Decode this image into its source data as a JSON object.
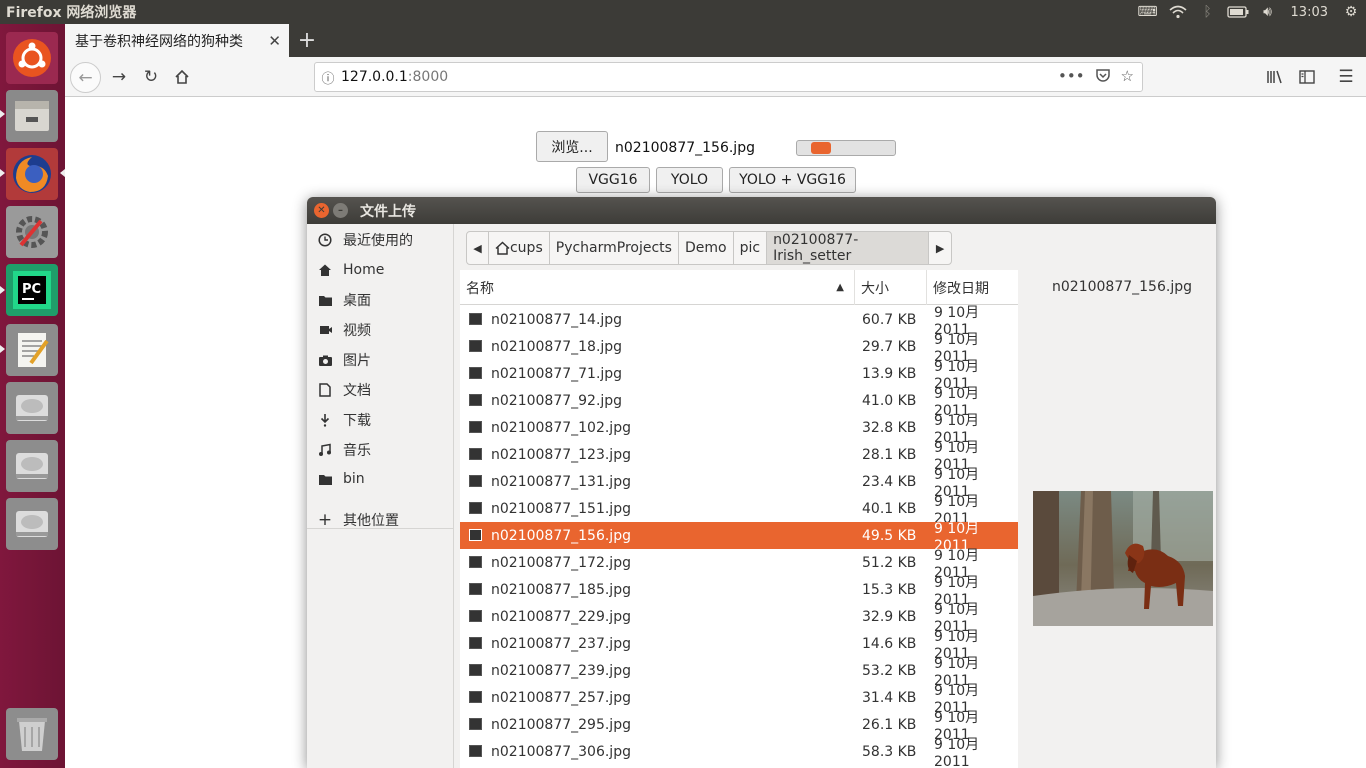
{
  "topbar": {
    "app_title": "Firefox 网络浏览器",
    "time": "13:03"
  },
  "browser": {
    "tab_title": "基于卷积神经网络的狗种类",
    "url_host": "127.0.0.1",
    "url_port": ":8000"
  },
  "page": {
    "browse_label": "浏览...",
    "selected_file": "n02100877_156.jpg",
    "upload_progress": 0.2,
    "buttons": [
      "VGG16",
      "YOLO",
      "YOLO + VGG16"
    ]
  },
  "dialog": {
    "title": "文件上传",
    "places": [
      {
        "label": "最近使用的",
        "icon": "clock-icon"
      },
      {
        "label": "Home",
        "icon": "home-icon"
      },
      {
        "label": "桌面",
        "icon": "folder-icon"
      },
      {
        "label": "视频",
        "icon": "video-icon"
      },
      {
        "label": "图片",
        "icon": "camera-icon"
      },
      {
        "label": "文档",
        "icon": "document-icon"
      },
      {
        "label": "下载",
        "icon": "download-icon"
      },
      {
        "label": "音乐",
        "icon": "music-icon"
      },
      {
        "label": "bin",
        "icon": "folder-icon"
      }
    ],
    "other_places": "其他位置",
    "breadcrumbs": [
      "cups",
      "PycharmProjects",
      "Demo",
      "pic",
      "n02100877-Irish_setter"
    ],
    "columns": {
      "name": "名称",
      "size": "大小",
      "modified": "修改日期"
    },
    "files": [
      {
        "name": "n02100877_14.jpg",
        "size": "60.7 KB",
        "date": "9 10月 2011"
      },
      {
        "name": "n02100877_18.jpg",
        "size": "29.7 KB",
        "date": "9 10月 2011"
      },
      {
        "name": "n02100877_71.jpg",
        "size": "13.9 KB",
        "date": "9 10月 2011"
      },
      {
        "name": "n02100877_92.jpg",
        "size": "41.0 KB",
        "date": "9 10月 2011"
      },
      {
        "name": "n02100877_102.jpg",
        "size": "32.8 KB",
        "date": "9 10月 2011"
      },
      {
        "name": "n02100877_123.jpg",
        "size": "28.1 KB",
        "date": "9 10月 2011"
      },
      {
        "name": "n02100877_131.jpg",
        "size": "23.4 KB",
        "date": "9 10月 2011"
      },
      {
        "name": "n02100877_151.jpg",
        "size": "40.1 KB",
        "date": "9 10月 2011"
      },
      {
        "name": "n02100877_156.jpg",
        "size": "49.5 KB",
        "date": "9 10月 2011",
        "selected": true
      },
      {
        "name": "n02100877_172.jpg",
        "size": "51.2 KB",
        "date": "9 10月 2011"
      },
      {
        "name": "n02100877_185.jpg",
        "size": "15.3 KB",
        "date": "9 10月 2011"
      },
      {
        "name": "n02100877_229.jpg",
        "size": "32.9 KB",
        "date": "9 10月 2011"
      },
      {
        "name": "n02100877_237.jpg",
        "size": "14.6 KB",
        "date": "9 10月 2011"
      },
      {
        "name": "n02100877_239.jpg",
        "size": "53.2 KB",
        "date": "9 10月 2011"
      },
      {
        "name": "n02100877_257.jpg",
        "size": "31.4 KB",
        "date": "9 10月 2011"
      },
      {
        "name": "n02100877_295.jpg",
        "size": "26.1 KB",
        "date": "9 10月 2011"
      },
      {
        "name": "n02100877_306.jpg",
        "size": "58.3 KB",
        "date": "9 10月 2011"
      }
    ],
    "preview_name": "n02100877_156.jpg"
  },
  "colors": {
    "accent": "#e9652f",
    "launcher": "#7a1a3e",
    "titlebar": "#3c3b37"
  }
}
